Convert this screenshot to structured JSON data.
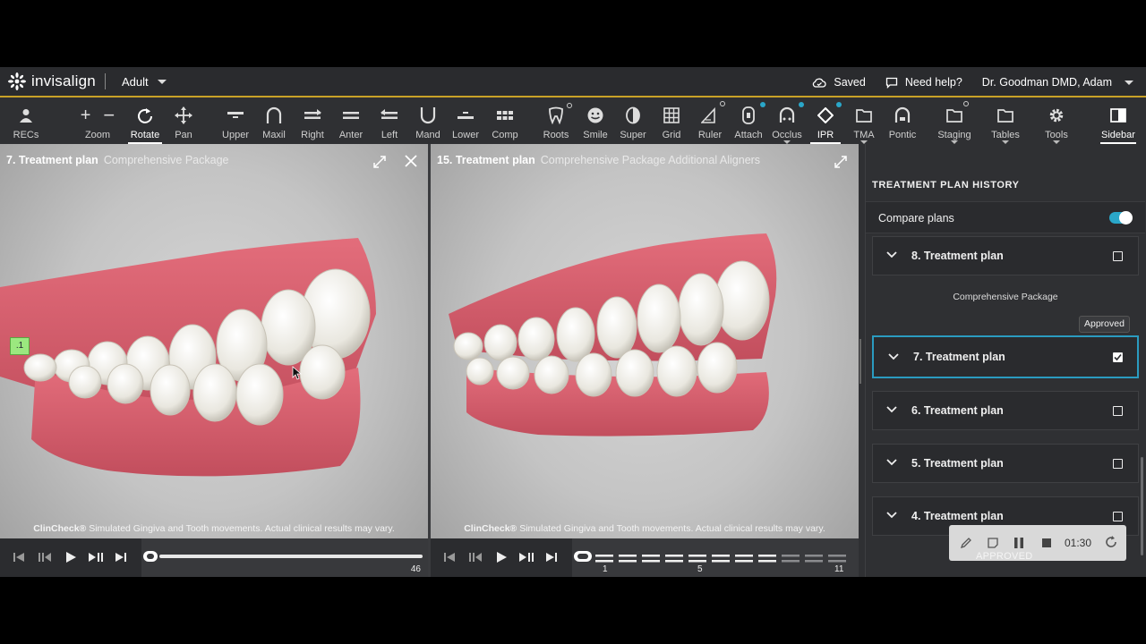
{
  "brand": {
    "name": "invisalign",
    "accent": "#c9a227"
  },
  "header": {
    "patient_type": "Adult",
    "saved_label": "Saved",
    "help_label": "Need help?",
    "user_name": "Dr. Goodman DMD, Adam"
  },
  "toolbar": {
    "recs": "RECs",
    "zoom": "Zoom",
    "rotate": "Rotate",
    "pan": "Pan",
    "upper": "Upper",
    "maxil": "Maxil",
    "right": "Right",
    "anter": "Anter",
    "left": "Left",
    "mand": "Mand",
    "lower": "Lower",
    "comp": "Comp",
    "roots": "Roots",
    "smile": "Smile",
    "super": "Super",
    "grid": "Grid",
    "ruler": "Ruler",
    "attach": "Attach",
    "occlus": "Occlus",
    "ipr": "IPR",
    "tma": "TMA",
    "pontic": "Pontic",
    "staging": "Staging",
    "tables": "Tables",
    "tools": "Tools",
    "sidebar": "Sidebar"
  },
  "viewport_left": {
    "title": "7. Treatment plan",
    "package": "Comprehensive Package",
    "tag": ".1",
    "disclaimer_brand": "ClinCheck®",
    "disclaimer_text": " Simulated Gingiva and Tooth movements. Actual clinical results may vary.",
    "stage_end": "46"
  },
  "viewport_right": {
    "title": "15. Treatment plan",
    "package": "Comprehensive Package Additional Aligners",
    "disclaimer_brand": "ClinCheck®",
    "disclaimer_text": " Simulated Gingiva and Tooth movements. Actual clinical results may vary.",
    "stage_labels": [
      "1",
      "5",
      "11"
    ]
  },
  "sidebar": {
    "heading": "TREATMENT PLAN HISTORY",
    "compare_label": "Compare plans",
    "compare_on": true,
    "package_label": "Comprehensive Package",
    "approved_badge": "Approved",
    "plans": [
      {
        "name": "8. Treatment plan",
        "checked": false
      },
      {
        "name": "7. Treatment plan",
        "checked": true
      },
      {
        "name": "6. Treatment plan",
        "checked": false
      },
      {
        "name": "5. Treatment plan",
        "checked": false
      },
      {
        "name": "4. Treatment plan",
        "checked": false
      }
    ]
  },
  "recorder": {
    "time": "01:30",
    "status": "APPROVED"
  }
}
